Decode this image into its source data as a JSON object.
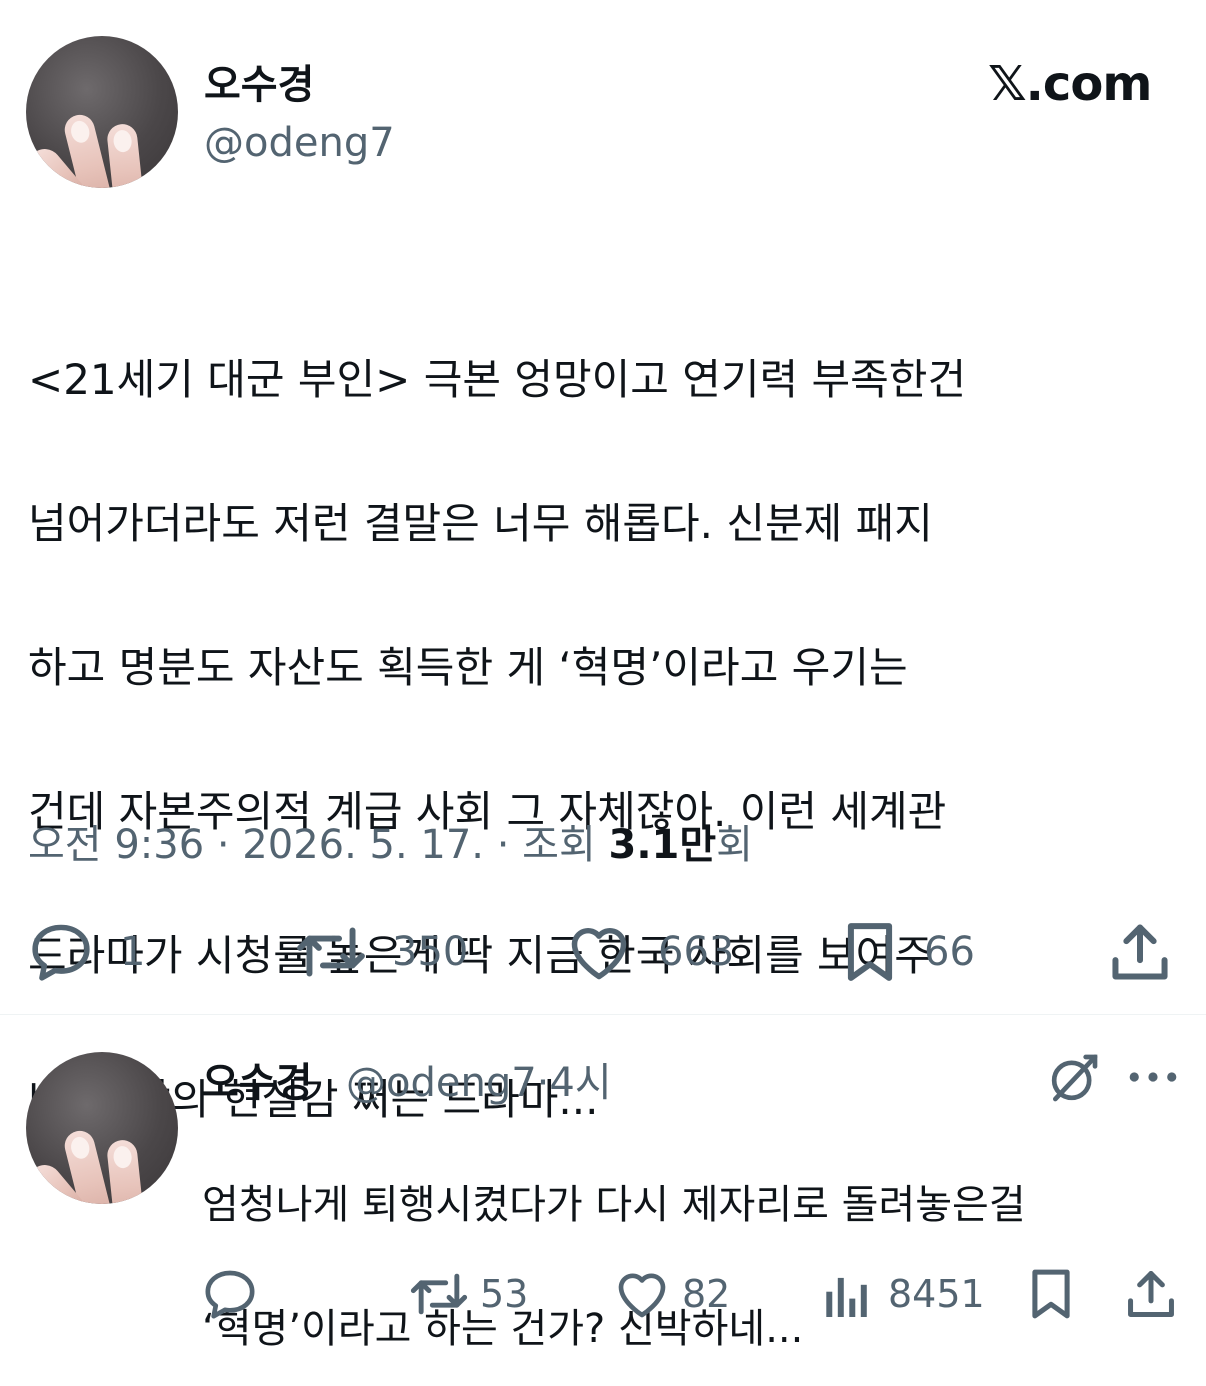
{
  "header": {
    "display_name": "오수경",
    "handle": "@odeng7",
    "site_logo": "𝕏.com"
  },
  "tweet": {
    "text_lines": [
      "<21세기 대군 부인> 극본 엉망이고 연기력 부족한건",
      "넘어가더라도 저런 결말은 너무 해롭다. 신분제 패지",
      "하고 명분도 자산도 획득한 게 ‘혁명’이라고 우기는",
      "건데 자본주의적 계급 사회 그 자체잖아. 이런 세계관",
      "드라마가 시청률 높은게 딱 지금 한국 사회를 보여주",
      "네. 뜻밖의 현실감 쩌는 드라마..."
    ],
    "meta": {
      "time": "오전 9:36",
      "date": "2026. 5. 17.",
      "views_label": "조회",
      "views_number": "3.1만",
      "views_suffix": "회",
      "separator": " · "
    },
    "actions": {
      "reply_count": "1",
      "retweet_count": "350",
      "like_count": "663",
      "bookmark_count": "66"
    }
  },
  "reply": {
    "display_name": "오수경",
    "handle": "@odeng7",
    "separator": "·",
    "time_ago": "4시",
    "text_lines": [
      "엄청나게 퇴행시켰다가 다시 제자리로 돌려놓은걸",
      "‘혁명’이라고 하는 건가? 신박하네..."
    ],
    "actions": {
      "retweet_count": "53",
      "like_count": "82",
      "views_count": "8451"
    }
  },
  "icons": {
    "reply": "speech-bubble-icon",
    "retweet": "retweet-arrows-icon",
    "like": "heart-icon",
    "bookmark": "bookmark-icon",
    "share": "share-upload-icon",
    "views": "bar-chart-icon",
    "grok": "grok-slash-circle-icon",
    "more": "ellipsis-icon"
  },
  "colors": {
    "text_primary": "#0f1419",
    "text_secondary": "#536471",
    "divider": "#eff3f4"
  }
}
